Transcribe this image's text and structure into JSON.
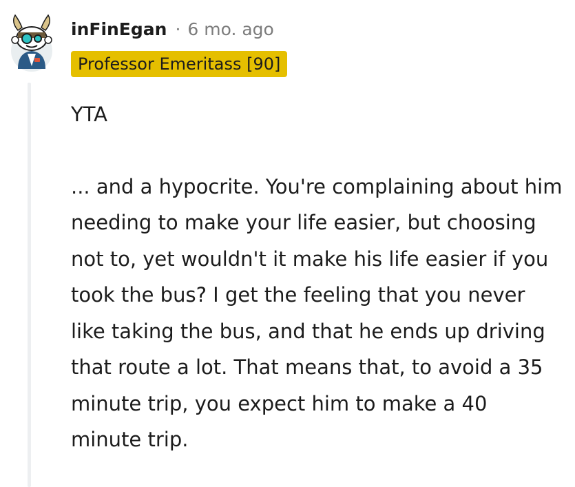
{
  "comment": {
    "username": "inFinEgan",
    "separator": "·",
    "timestamp": "6 mo. ago",
    "flair": "Professor Emeritass [90]",
    "paragraphs": [
      "YTA",
      "... and a hypocrite. You're complaining about him needing to make your life easier, but choosing not to, yet wouldn't it make his life easier if you took the bus? I get the feeling that you never like taking the bus, and that he ends up driving that route a lot. That means that, to avoid a 35 minute trip, you expect him to make a 40 minute trip."
    ]
  },
  "colors": {
    "flair_background": "#e5bf00",
    "text": "#1c1c1c",
    "meta_text": "#7c7c7c",
    "thread_line": "#edeff1"
  }
}
